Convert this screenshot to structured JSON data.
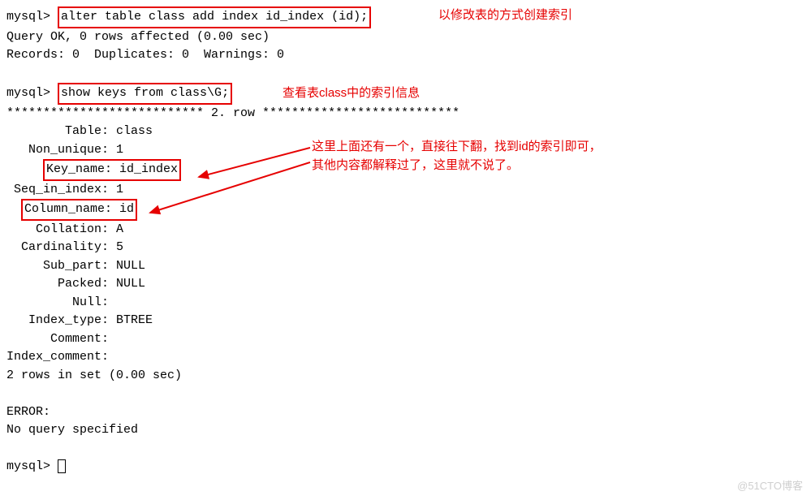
{
  "prompt1": "mysql>",
  "cmd1": "alter table class add index id_index (id);",
  "res1a": "Query OK, 0 rows affected (0.00 sec)",
  "res1b": "Records: 0  Duplicates: 0  Warnings: 0",
  "prompt2": "mysql>",
  "cmd2": "show keys from class\\G;",
  "rowheader": "*************************** 2. row ***************************",
  "fields": {
    "table": "        Table: class",
    "non_unique": "   Non_unique: 1",
    "key_pre": "     ",
    "key_name": "Key_name: id_index",
    "seq": " Seq_in_index: 1",
    "col_pre": "  ",
    "col_name": "Column_name: id",
    "collation": "    Collation: A",
    "cardinality": "  Cardinality: 5",
    "sub_part": "     Sub_part: NULL",
    "packed": "       Packed: NULL",
    "null": "         Null:",
    "index_type": "   Index_type: BTREE",
    "comment": "      Comment:",
    "index_comment": "Index_comment:"
  },
  "rows_in_set": "2 rows in set (0.00 sec)",
  "error": "ERROR:",
  "noquery": "No query specified",
  "prompt3": "mysql>",
  "anno1": "以修改表的方式创建索引",
  "anno2": "查看表class中的索引信息",
  "anno3a": "这里上面还有一个，直接往下翻，找到id的索引即可，",
  "anno3b": "其他内容都解释过了，这里就不说了。",
  "watermark": "@51CTO博客"
}
